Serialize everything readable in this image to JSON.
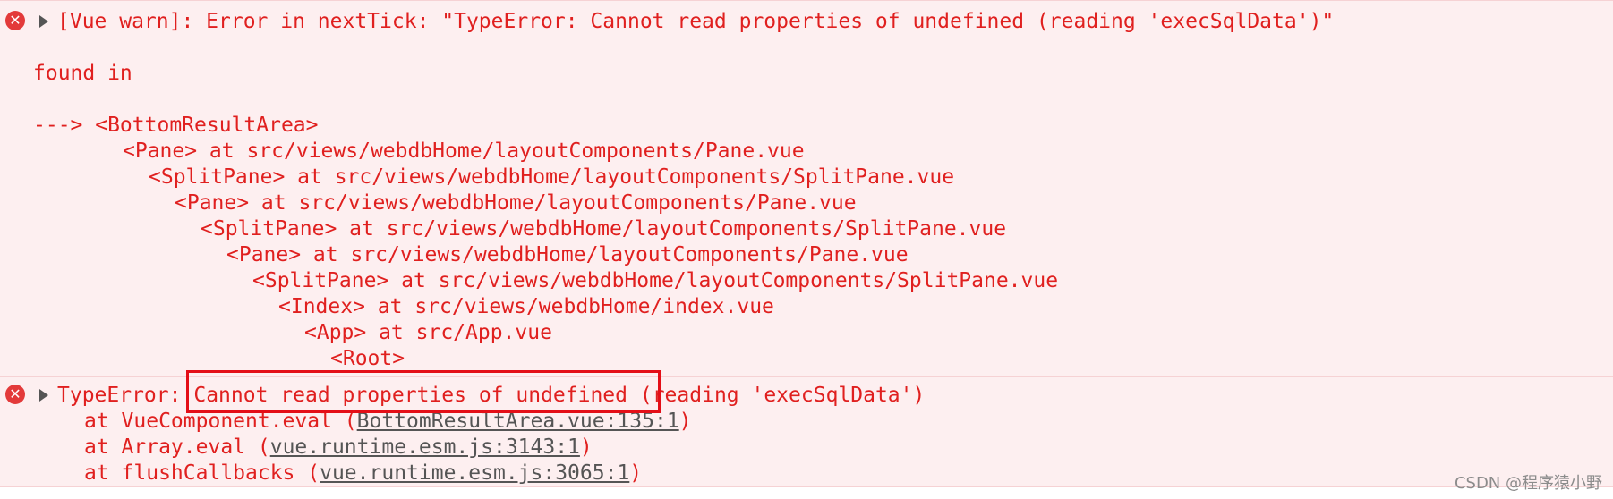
{
  "entries": [
    {
      "level": "error",
      "message": "[Vue warn]: Error in nextTick: \"TypeError: Cannot read properties of undefined (reading 'execSqlData')\"",
      "found_in": "found in",
      "trace": [
        "---> <BottomResultArea>",
        "<Pane> at src/views/webdbHome/layoutComponents/Pane.vue",
        "<SplitPane> at src/views/webdbHome/layoutComponents/SplitPane.vue",
        "<Pane> at src/views/webdbHome/layoutComponents/Pane.vue",
        "<SplitPane> at src/views/webdbHome/layoutComponents/SplitPane.vue",
        "<Pane> at src/views/webdbHome/layoutComponents/Pane.vue",
        "<SplitPane> at src/views/webdbHome/layoutComponents/SplitPane.vue",
        "<Index> at src/views/webdbHome/index.vue",
        "<App> at src/App.vue",
        "<Root>"
      ]
    },
    {
      "level": "error",
      "error_type": "TypeError:",
      "error_highlight": "Cannot read properties of undefined",
      "error_rest": "(reading 'execSqlData')",
      "stack": [
        {
          "prefix": "at VueComponent.eval (",
          "link": "BottomResultArea.vue:135:1",
          "suffix": ")"
        },
        {
          "prefix": "at Array.eval (",
          "link": "vue.runtime.esm.js:3143:1",
          "suffix": ")"
        },
        {
          "prefix": "at flushCallbacks (",
          "link": "vue.runtime.esm.js:3065:1",
          "suffix": ")"
        }
      ]
    }
  ],
  "icons": {
    "error": "error-circle-x-icon",
    "expand": "disclosure-triangle-icon"
  },
  "colors": {
    "error_text": "#e0201f",
    "error_bg": "#fdeff0",
    "highlight_border": "#e40e17",
    "link": "#555555"
  },
  "watermark": "CSDN @程序猿小野"
}
